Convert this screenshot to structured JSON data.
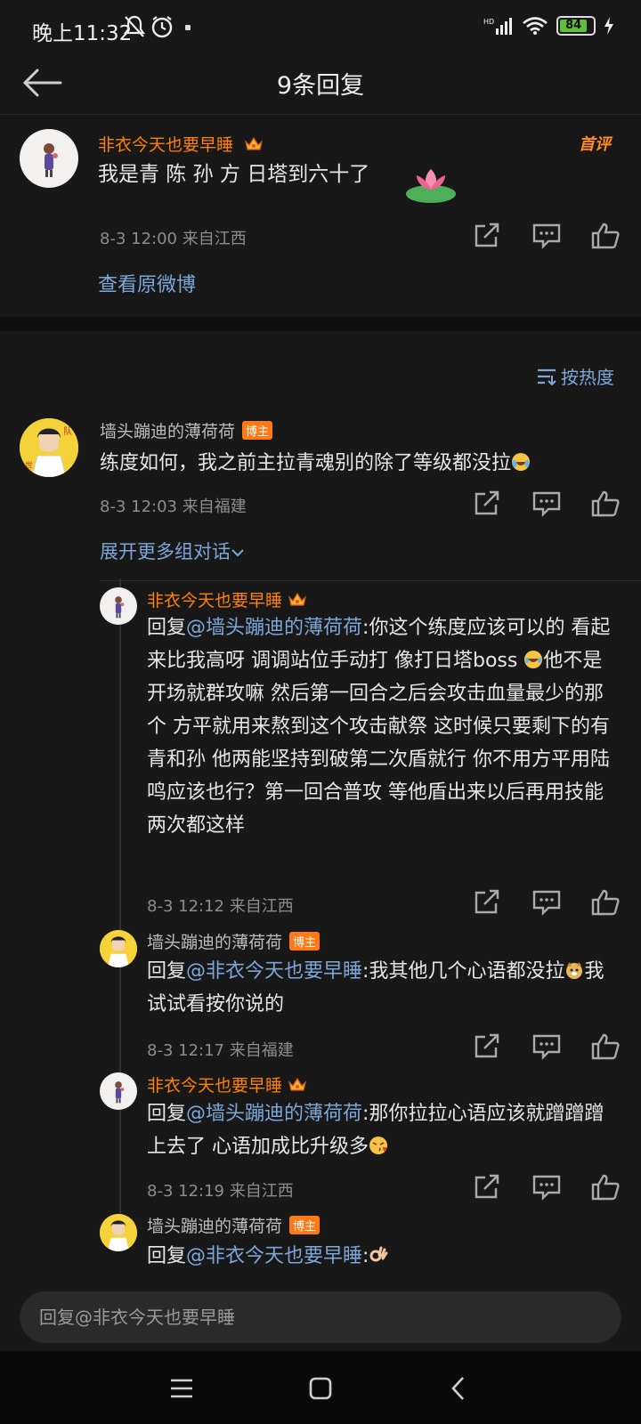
{
  "status": {
    "time": "晚上11:32",
    "battery": "84"
  },
  "header": {
    "title": "9条回复"
  },
  "original": {
    "name": "非衣今天也要早睡",
    "badge": "首评",
    "text": "我是青 陈 孙 方 日塔到六十了",
    "meta": "8-3 12:00 来自江西",
    "link": "查看原微博"
  },
  "sort": {
    "label": "按热度"
  },
  "comment": {
    "name": "墙头蹦迪的薄荷荷",
    "tag": "博主",
    "text": "练度如何，我之前主拉青魂别的除了等级都没拉",
    "meta": "8-3 12:03 来自福建",
    "expand": "展开更多组对话"
  },
  "replies": [
    {
      "name": "非衣今天也要早睡",
      "prefix": "回复",
      "mention": "@墙头蹦迪的薄荷荷",
      "body": ":你这个练度应该可以的 看起来比我高呀 调调站位手动打 像打日塔boss",
      "body2": "他不是开场就群攻嘛 然后第一回合之后会攻击血量最少的那个 方平就用来熬到这个攻击献祭  这时候只要剩下的有青和孙 他两能坚持到破第二次盾就行 你不用方平用陆鸣应该也行？第一回合普攻 等他盾出来以后再用技能两次都这样",
      "meta": "8-3 12:12 来自江西"
    },
    {
      "name": "墙头蹦迪的薄荷荷",
      "tag": "博主",
      "prefix": "回复",
      "mention": "@非衣今天也要早睡",
      "body": ":我其他几个心语都没拉",
      "body2": "我试试看按你说的",
      "meta": "8-3 12:17 来自福建"
    },
    {
      "name": "非衣今天也要早睡",
      "prefix": "回复",
      "mention": "@墙头蹦迪的薄荷荷",
      "body": ":那你拉拉心语应该就蹭蹭蹭上去了 心语加成比升级多",
      "meta": "8-3 12:19 来自江西"
    },
    {
      "name": "墙头蹦迪的薄荷荷",
      "tag": "博主",
      "prefix": "回复",
      "mention": "@非衣今天也要早睡",
      "body": ":"
    }
  ],
  "input": {
    "placeholder": "回复@非衣今天也要早睡"
  },
  "colors": {
    "orange": "#ff8200",
    "link": "#7da7d9",
    "background": "#181818"
  }
}
